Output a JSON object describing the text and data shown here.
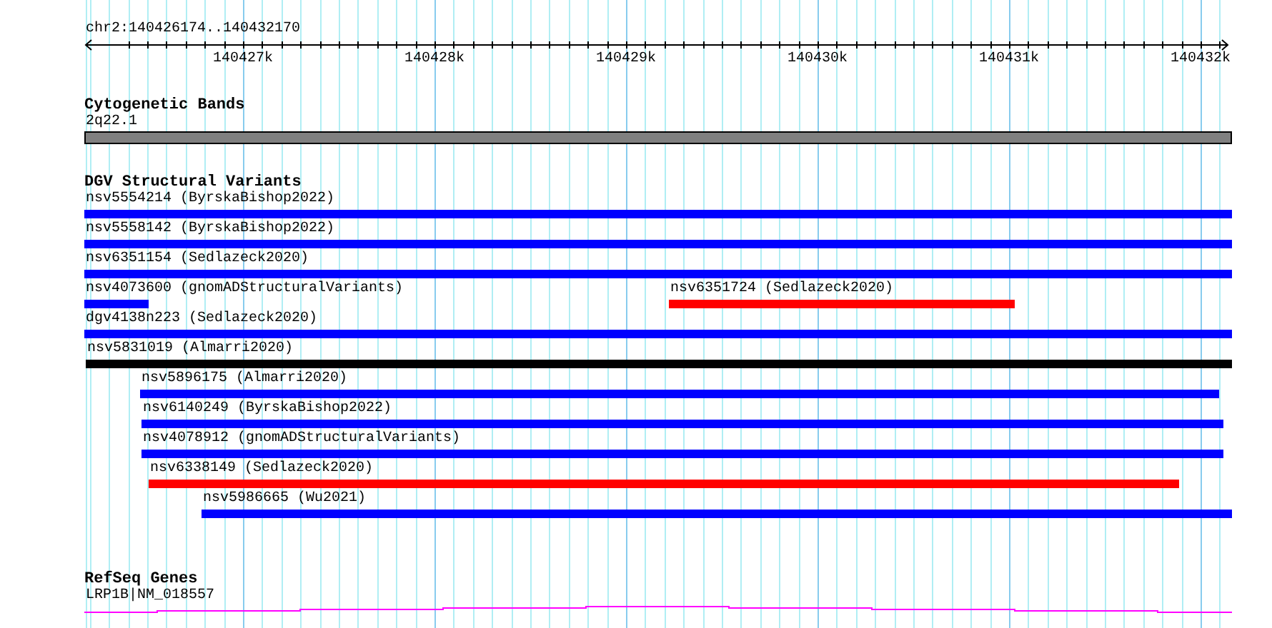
{
  "location": "chr2:140426174..140432170",
  "ruler": {
    "ticks": [
      "140427k",
      "140428k",
      "140429k",
      "140430k",
      "140431k",
      "140432k"
    ]
  },
  "tracks": [
    {
      "title": "Cytogenetic Bands",
      "kind": "band",
      "features": [
        {
          "label": "2q22.1",
          "color": "#808080"
        }
      ]
    },
    {
      "title": "DGV Structural Variants",
      "kind": "variants",
      "features": [
        {
          "label": "nsv5554214 (ByrskaBishop2022)",
          "color": "#0000ff"
        },
        {
          "label": "nsv5558142 (ByrskaBishop2022)",
          "color": "#0000ff"
        },
        {
          "label": "nsv6351154 (Sedlazeck2020)",
          "color": "#0000ff"
        },
        {
          "label": "nsv4073600 (gnomADStructuralVariants)",
          "color": "#0000ff"
        },
        {
          "label": "nsv6351724 (Sedlazeck2020)",
          "color": "#ff0000"
        },
        {
          "label": "dgv4138n223 (Sedlazeck2020)",
          "color": "#0000ff"
        },
        {
          "label": "nsv5831019 (Almarri2020)",
          "color": "#000000"
        },
        {
          "label": "nsv5896175 (Almarri2020)",
          "color": "#0000ff"
        },
        {
          "label": "nsv6140249 (ByrskaBishop2022)",
          "color": "#0000ff"
        },
        {
          "label": "nsv4078912 (gnomADStructuralVariants)",
          "color": "#0000ff"
        },
        {
          "label": "nsv6338149 (Sedlazeck2020)",
          "color": "#ff0000"
        },
        {
          "label": "nsv5986665 (Wu2021)",
          "color": "#0000ff"
        }
      ]
    },
    {
      "title": "RefSeq Genes",
      "kind": "gene",
      "features": [
        {
          "label": "LRP1B|NM_018557",
          "color": "#ff00ff"
        }
      ]
    }
  ]
}
